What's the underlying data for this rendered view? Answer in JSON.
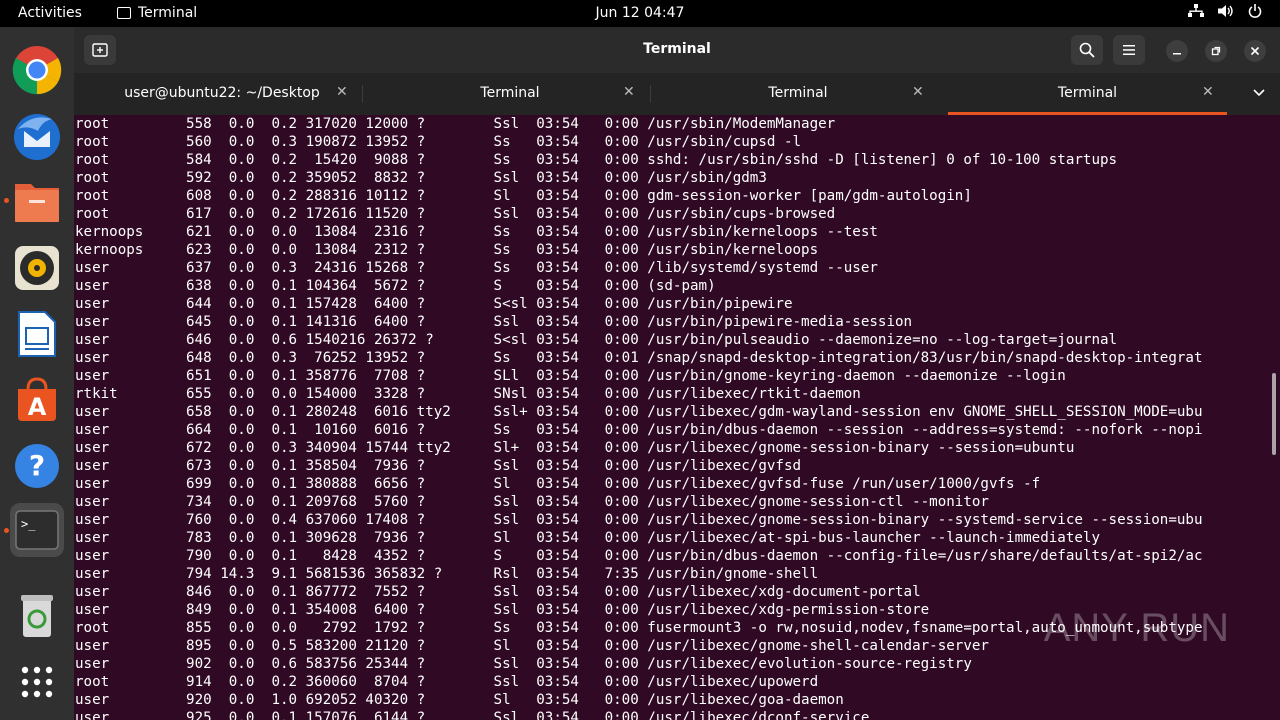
{
  "topbar": {
    "activities": "Activities",
    "app_name": "Terminal",
    "clock": "Jun 12  04:47"
  },
  "dock": {
    "items": [
      "google-chrome",
      "thunderbird",
      "files",
      "rhythmbox",
      "libreoffice-writer",
      "ubuntu-software",
      "help",
      "terminal",
      "trash",
      "show-applications"
    ]
  },
  "window": {
    "title": "Terminal",
    "tabs": [
      {
        "label": "user@ubuntu22: ~/Desktop",
        "active": false
      },
      {
        "label": "Terminal",
        "active": false
      },
      {
        "label": "Terminal",
        "active": false
      },
      {
        "label": "Terminal",
        "active": true
      }
    ]
  },
  "terminal": {
    "lines": [
      "root         558  0.0  0.2 317020 12000 ?        Ssl  03:54   0:00 /usr/sbin/ModemManager",
      "root         560  0.0  0.3 190872 13952 ?        Ss   03:54   0:00 /usr/sbin/cupsd -l",
      "root         584  0.0  0.2  15420  9088 ?        Ss   03:54   0:00 sshd: /usr/sbin/sshd -D [listener] 0 of 10-100 startups",
      "root         592  0.0  0.2 359052  8832 ?        Ssl  03:54   0:00 /usr/sbin/gdm3",
      "root         608  0.0  0.2 288316 10112 ?        Sl   03:54   0:00 gdm-session-worker [pam/gdm-autologin]",
      "root         617  0.0  0.2 172616 11520 ?        Ssl  03:54   0:00 /usr/sbin/cups-browsed",
      "kernoops     621  0.0  0.0  13084  2316 ?        Ss   03:54   0:00 /usr/sbin/kerneloops --test",
      "kernoops     623  0.0  0.0  13084  2312 ?        Ss   03:54   0:00 /usr/sbin/kerneloops",
      "user         637  0.0  0.3  24316 15268 ?        Ss   03:54   0:00 /lib/systemd/systemd --user",
      "user         638  0.0  0.1 104364  5672 ?        S    03:54   0:00 (sd-pam)",
      "user         644  0.0  0.1 157428  6400 ?        S<sl 03:54   0:00 /usr/bin/pipewire",
      "user         645  0.0  0.1 141316  6400 ?        Ssl  03:54   0:00 /usr/bin/pipewire-media-session",
      "user         646  0.0  0.6 1540216 26372 ?       S<sl 03:54   0:00 /usr/bin/pulseaudio --daemonize=no --log-target=journal",
      "user         648  0.0  0.3  76252 13952 ?        Ss   03:54   0:01 /snap/snapd-desktop-integration/83/usr/bin/snapd-desktop-integrat",
      "user         651  0.0  0.1 358776  7708 ?        SLl  03:54   0:00 /usr/bin/gnome-keyring-daemon --daemonize --login",
      "rtkit        655  0.0  0.0 154000  3328 ?        SNsl 03:54   0:00 /usr/libexec/rtkit-daemon",
      "user         658  0.0  0.1 280248  6016 tty2     Ssl+ 03:54   0:00 /usr/libexec/gdm-wayland-session env GNOME_SHELL_SESSION_MODE=ubu",
      "user         664  0.0  0.1  10160  6016 ?        Ss   03:54   0:00 /usr/bin/dbus-daemon --session --address=systemd: --nofork --nopi",
      "user         672  0.0  0.3 340904 15744 tty2     Sl+  03:54   0:00 /usr/libexec/gnome-session-binary --session=ubuntu",
      "user         673  0.0  0.1 358504  7936 ?        Ssl  03:54   0:00 /usr/libexec/gvfsd",
      "user         699  0.0  0.1 380888  6656 ?        Sl   03:54   0:00 /usr/libexec/gvfsd-fuse /run/user/1000/gvfs -f",
      "user         734  0.0  0.1 209768  5760 ?        Ssl  03:54   0:00 /usr/libexec/gnome-session-ctl --monitor",
      "user         760  0.0  0.4 637060 17408 ?        Ssl  03:54   0:00 /usr/libexec/gnome-session-binary --systemd-service --session=ubu",
      "user         783  0.0  0.1 309628  7936 ?        Sl   03:54   0:00 /usr/libexec/at-spi-bus-launcher --launch-immediately",
      "user         790  0.0  0.1   8428  4352 ?        S    03:54   0:00 /usr/bin/dbus-daemon --config-file=/usr/share/defaults/at-spi2/ac",
      "user         794 14.3  9.1 5681536 365832 ?      Rsl  03:54   7:35 /usr/bin/gnome-shell",
      "user         846  0.0  0.1 867772  7552 ?        Ssl  03:54   0:00 /usr/libexec/xdg-document-portal",
      "user         849  0.0  0.1 354008  6400 ?        Ssl  03:54   0:00 /usr/libexec/xdg-permission-store",
      "root         855  0.0  0.0   2792  1792 ?        Ss   03:54   0:00 fusermount3 -o rw,nosuid,nodev,fsname=portal,auto_unmount,subtype",
      "user         895  0.0  0.5 583200 21120 ?        Sl   03:54   0:00 /usr/libexec/gnome-shell-calendar-server",
      "user         902  0.0  0.6 583756 25344 ?        Ssl  03:54   0:00 /usr/libexec/evolution-source-registry",
      "root         914  0.0  0.2 360060  8704 ?        Ssl  03:54   0:00 /usr/libexec/upowerd",
      "user         920  0.0  1.0 692052 40320 ?        Sl   03:54   0:00 /usr/libexec/goa-daemon",
      "user         925  0.0  0.1 157076  6144 ?        Ssl  03:54   0:00 /usr/libexec/dconf-service"
    ]
  },
  "watermark": "ANY RUN"
}
